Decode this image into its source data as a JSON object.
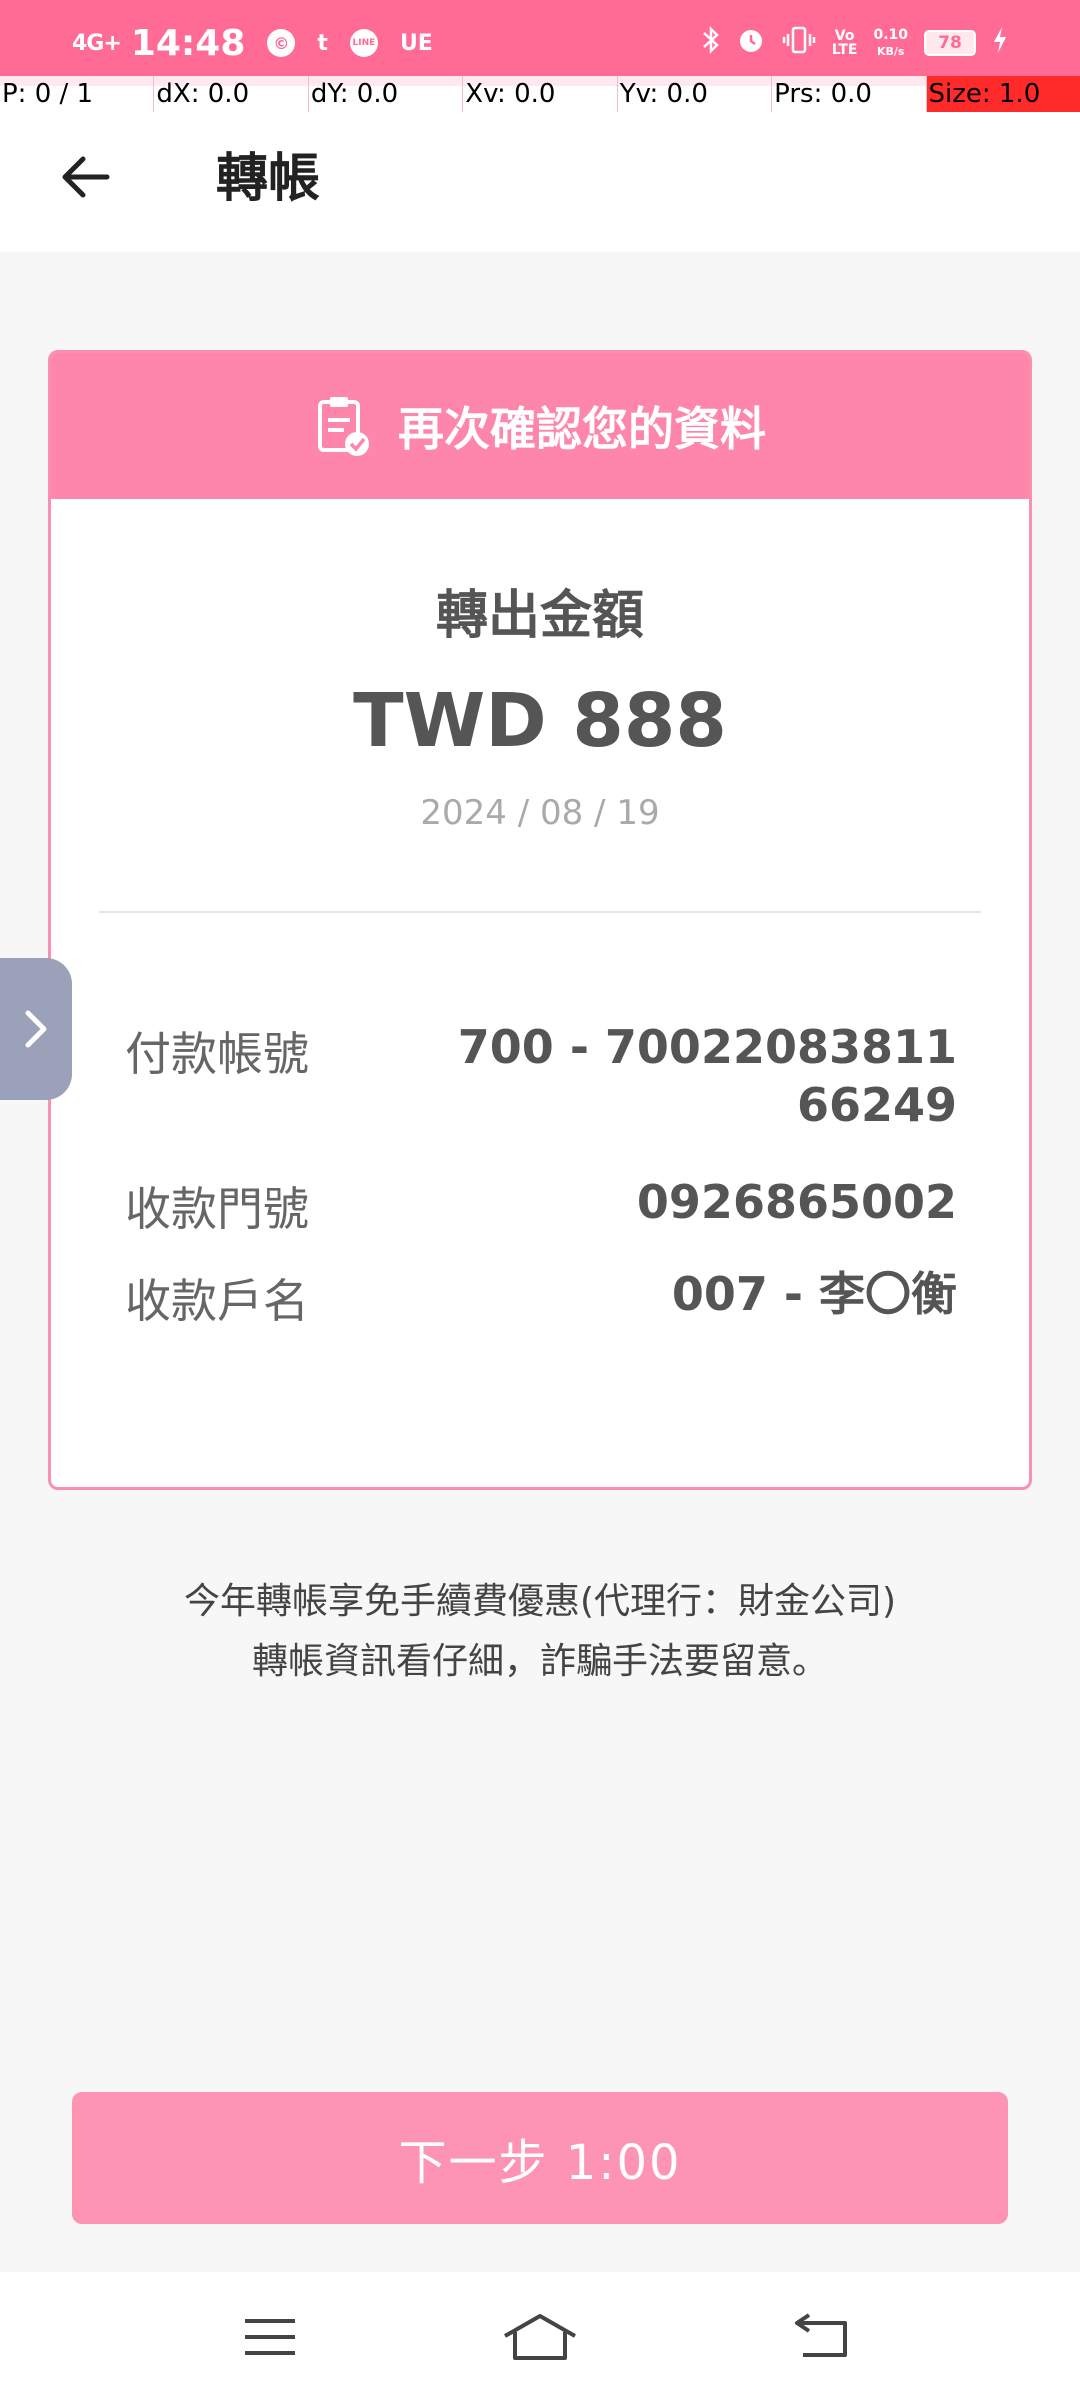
{
  "status_bar": {
    "signal": "4G+",
    "time": "14:48",
    "notif_icons": [
      "©",
      "t",
      "LINE",
      "UE"
    ],
    "speed_value": "0.10",
    "speed_unit": "KB/s",
    "battery": "78"
  },
  "debug_bar": {
    "p": "P: 0 / 1",
    "dx": "dX: 0.0",
    "dy": "dY: 0.0",
    "xv": "Xv: 0.0",
    "yv": "Yv: 0.0",
    "prs": "Prs: 0.0",
    "size": "Size: 1.0"
  },
  "header": {
    "title": "轉帳"
  },
  "card": {
    "header_label": "再次確認您的資料",
    "amount_label": "轉出金額",
    "amount": "TWD 888",
    "date": "2024 / 08 / 19",
    "rows": [
      {
        "label": "付款帳號",
        "value": "700 - 7002208381166249"
      },
      {
        "label": "收款門號",
        "value": "0926865002"
      },
      {
        "label": "收款戶名",
        "value": "007 - 李〇衡"
      }
    ]
  },
  "notice": {
    "line1": "今年轉帳享免手續費優惠(代理行：財金公司)",
    "line2": "轉帳資訊看仔細，詐騙手法要留意。"
  },
  "next_button": {
    "label": "下一步 1:00"
  },
  "colors": {
    "status_bar": "#ff6b94",
    "card_header": "#fd86aa",
    "button": "#fd94b4",
    "card_border": "#fb8fb0"
  }
}
